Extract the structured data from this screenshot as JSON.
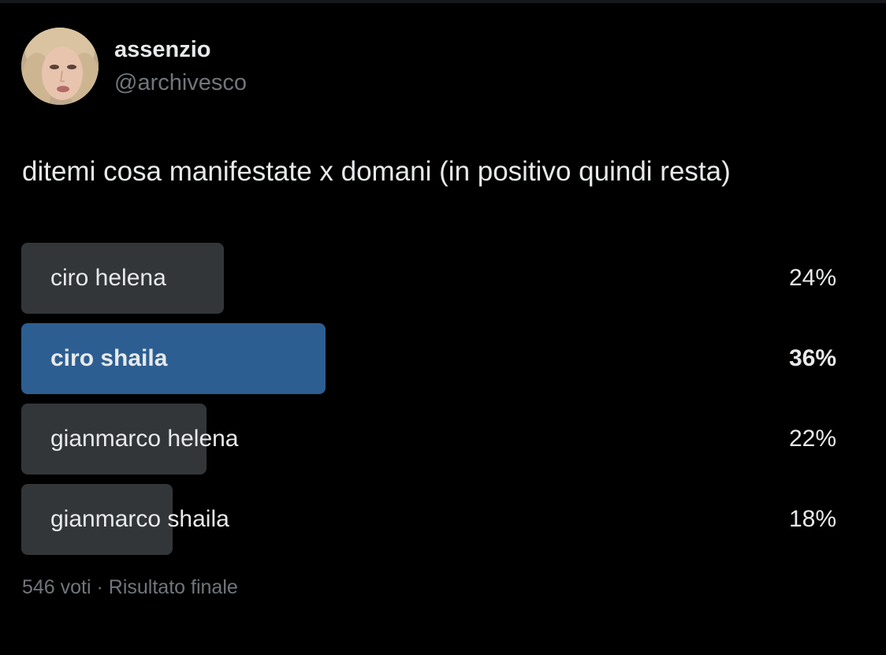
{
  "author": {
    "display_name": "assenzio",
    "handle": "@archivesco"
  },
  "tweet": {
    "text": "ditemi cosa manifestate x domani (in positivo quindi resta)"
  },
  "poll": {
    "options": [
      {
        "label": "ciro helena",
        "percent_text": "24%",
        "percent": 24,
        "winner": false
      },
      {
        "label": "ciro shaila",
        "percent_text": "36%",
        "percent": 36,
        "winner": true
      },
      {
        "label": "gianmarco helena",
        "percent_text": "22%",
        "percent": 22,
        "winner": false
      },
      {
        "label": "gianmarco shaila",
        "percent_text": "18%",
        "percent": 18,
        "winner": false
      }
    ],
    "votes": "546 voti",
    "separator": "·",
    "status": "Risultato finale"
  },
  "colors": {
    "background": "#000000",
    "text": "#e7e9ea",
    "muted": "#71767b",
    "bar": "#333639",
    "winner_bar": "#2d5e91"
  }
}
